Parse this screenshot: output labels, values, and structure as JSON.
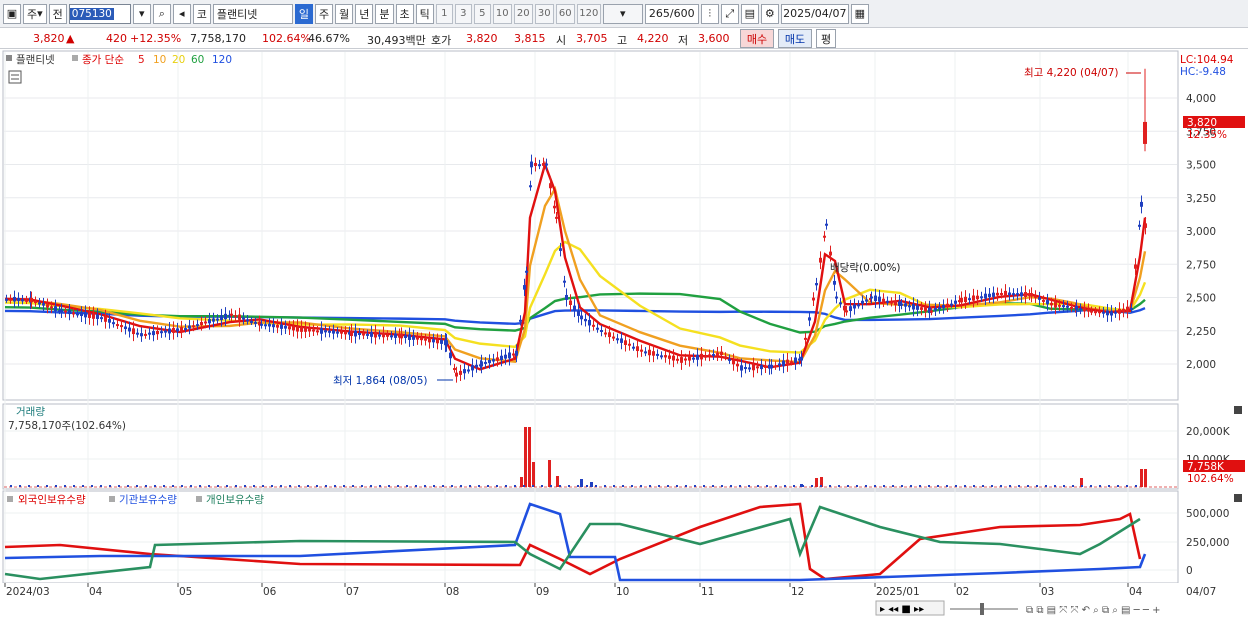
{
  "toolbar": {
    "market": "주",
    "prev": "전",
    "code": "075130",
    "type": "코",
    "name": "플랜티넷",
    "periods": [
      "일",
      "주",
      "월",
      "년",
      "분",
      "초",
      "틱"
    ],
    "selected_period": "일",
    "intervals": [
      "1",
      "3",
      "5",
      "10",
      "20",
      "30",
      "60",
      "120"
    ],
    "count": "265",
    "total": "/600",
    "date": "2025/04/07"
  },
  "quote": {
    "price": "3,820",
    "change": "420",
    "rate": "+12.35%",
    "volume": "7,758,170",
    "vol_ratio": "102.64%",
    "turnover": "46.67%",
    "amount": "30,493백만",
    "hoga_label": "호가",
    "hoga1": "3,820",
    "hoga2": "3,815",
    "open_label": "시",
    "open": "3,705",
    "high_label": "고",
    "high": "4,220",
    "low_label": "저",
    "low": "3,600",
    "buy": "매수",
    "sell": "매도",
    "eval": "평"
  },
  "price_panel": {
    "title": "플랜티넷",
    "ma_label": "종가 단순",
    "ma": [
      "5",
      "10",
      "20",
      "60",
      "120"
    ],
    "lc": "LC:104.94",
    "hc": "HC:-9.48",
    "high_note": "최고 4,220 (04/07)",
    "low_note": "최저 1,864 (08/05)",
    "dividend_note": "배당락(0.00%)",
    "cur_price": "3,820",
    "cur_rate": "12.35%",
    "yticks": [
      "4,000",
      "3,750",
      "3,500",
      "3,250",
      "3,000",
      "2,750",
      "2,500",
      "2,250",
      "2,000"
    ],
    "colors": {
      "ma5": "#e01010",
      "ma10": "#f0a020",
      "ma20": "#f5e020",
      "ma60": "#20a040",
      "ma120": "#2050e0",
      "up": "#e02020",
      "down": "#2040c0"
    }
  },
  "volume_panel": {
    "title": "거래량",
    "value": "7,758,170주(102.64%)",
    "yticks": [
      "20,000K",
      "10,000K"
    ],
    "cur": "7,758K",
    "cur_rate": "102.64%"
  },
  "holding_panel": {
    "series": [
      "외국인보유수량",
      "기관보유수량",
      "개인보유수량"
    ],
    "yticks": [
      "500,000",
      "250,000",
      "0"
    ]
  },
  "xaxis": [
    "2024/03",
    "04",
    "05",
    "06",
    "07",
    "08",
    "09",
    "10",
    "11",
    "12",
    "2025/01",
    "02",
    "03",
    "04"
  ],
  "xaxis_right": "04/07"
}
